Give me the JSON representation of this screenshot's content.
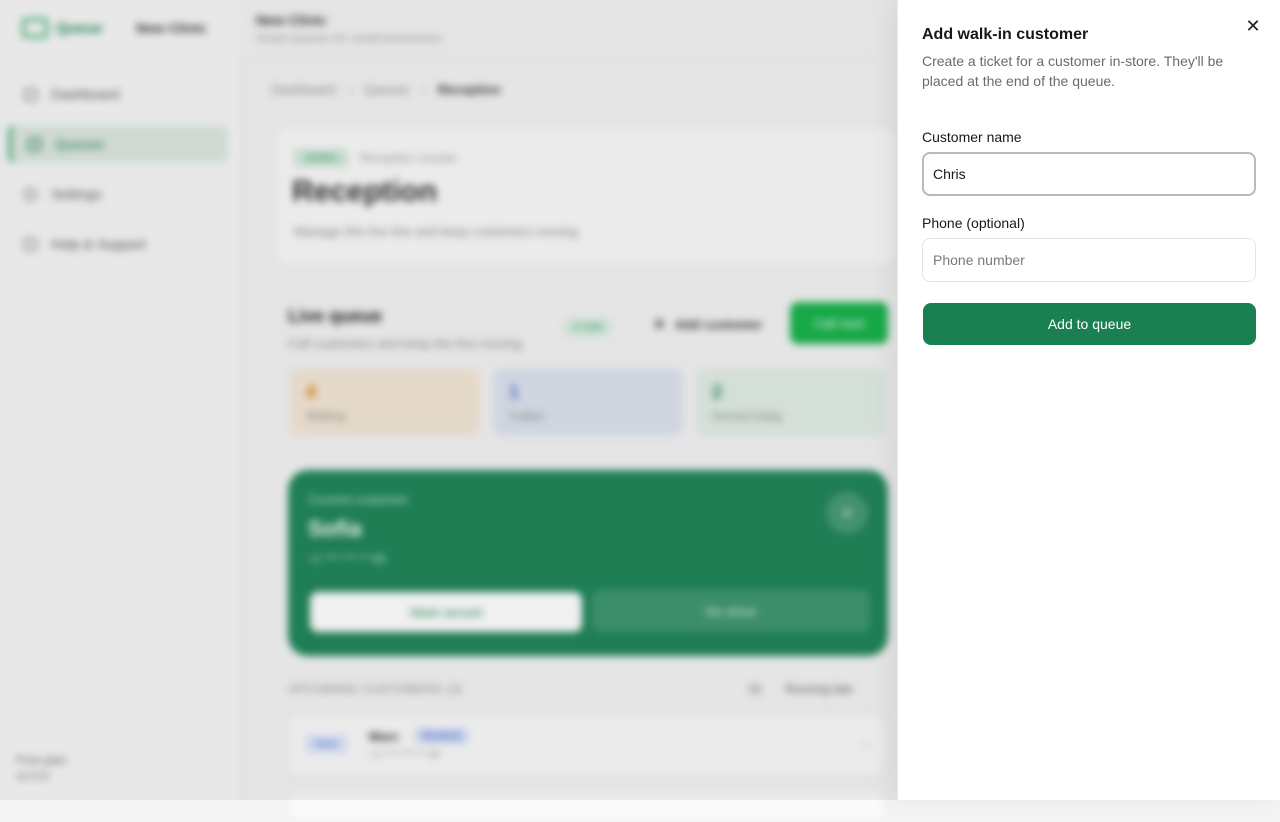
{
  "sidebar": {
    "brand": "Queue",
    "business": "New Clinic",
    "items": [
      {
        "label": "Dashboard",
        "icon": "grid-icon"
      },
      {
        "label": "Queues",
        "icon": "list-icon"
      },
      {
        "label": "Settings",
        "icon": "gear-icon"
      },
      {
        "label": "Help & Support",
        "icon": "help-icon"
      }
    ],
    "footer_line1": "Free plan",
    "footer_line2": "v1.0.0"
  },
  "topbar": {
    "title": "New Clinic",
    "subtitle": "Smart queues for small businesses"
  },
  "breadcrumb": [
    "Dashboard",
    "Queues",
    "Reception"
  ],
  "header_card": {
    "badge": "Active",
    "meta": "Reception counter",
    "title": "Reception",
    "description": "Manage this live line and keep customers moving"
  },
  "live_queue": {
    "title": "Live queue",
    "subtitle": "Call customers and keep the line moving",
    "badge": "1 Live",
    "add_customer_label": "Add customer",
    "call_next_label": "Call next",
    "stats": [
      {
        "value": "4",
        "label": "Waiting",
        "color": "#d97706",
        "bg": "#f3e7d6"
      },
      {
        "value": "1",
        "label": "Called",
        "color": "#4f6bd6",
        "bg": "#dde3ee"
      },
      {
        "value": "2",
        "label": "Served today",
        "color": "#1f8a57",
        "bg": "#e1ede5"
      }
    ]
  },
  "current_customer": {
    "label": "Current customer",
    "name": "Sofia",
    "phone": "+1 *** *** ** 89",
    "mark_served": "Mark served",
    "no_show": "No show"
  },
  "upcoming": {
    "label": "UPCOMING CUSTOMERS (3)",
    "sort_value": "15",
    "running_late": "Running late",
    "rows": [
      {
        "tag": "Next",
        "name": "Marc",
        "badge": "Booked",
        "phone": "+1 *** *** ** 40"
      }
    ]
  },
  "drawer": {
    "title": "Add walk-in customer",
    "description": "Create a ticket for a customer in-store. They'll be placed at the end of the queue.",
    "name_label": "Customer name",
    "name_value": "Chris",
    "phone_label": "Phone (optional)",
    "phone_placeholder": "Phone number",
    "submit_label": "Add to queue",
    "close_icon": "close-icon"
  }
}
